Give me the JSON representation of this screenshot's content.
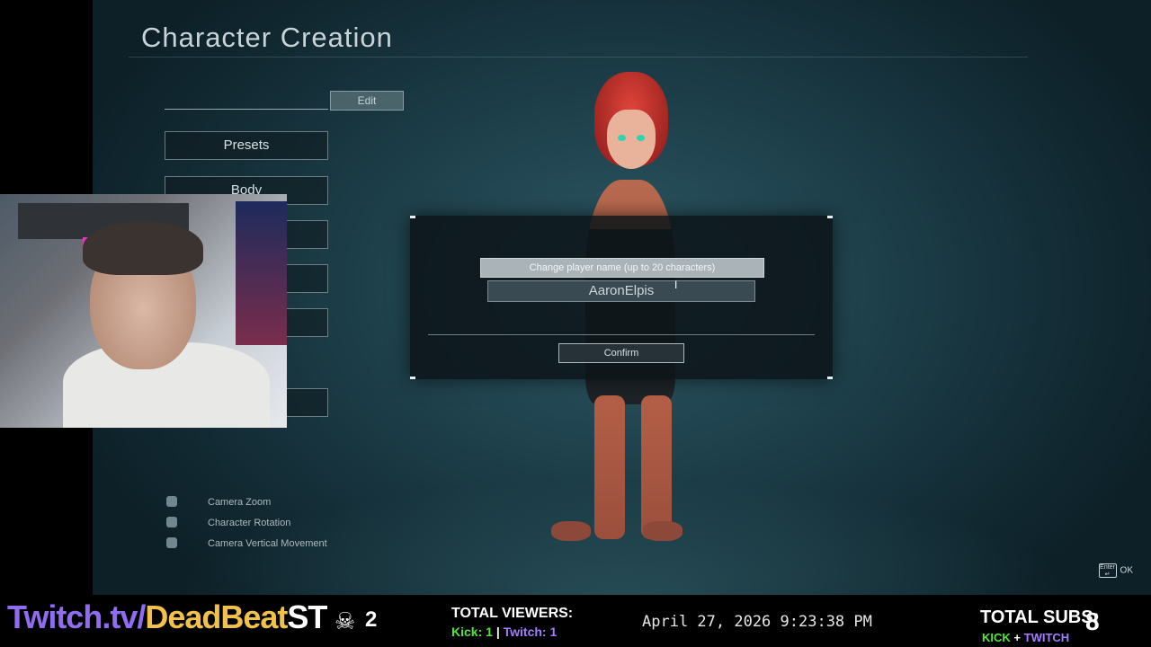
{
  "game": {
    "title": "Character Creation",
    "edit_label": "Edit",
    "menu": [
      "Presets",
      "Body",
      "",
      "",
      "",
      ""
    ],
    "hints": [
      {
        "icon": "mouse-scroll-icon",
        "label": "Camera Zoom"
      },
      {
        "icon": "mouse-drag-icon",
        "label": "Character Rotation"
      },
      {
        "icon": "mouse-vertical-icon",
        "label": "Camera Vertical Movement"
      }
    ],
    "ok_hint": {
      "key": "Enter ↵",
      "label": "OK"
    }
  },
  "dialog": {
    "header": "Change player name (up to 20 characters)",
    "name_value": "AaronElpis",
    "confirm_label": "Confirm"
  },
  "stream": {
    "brand_part1": "Twitch.tv/",
    "brand_part2": "DeadBeat",
    "brand_part3": "ST",
    "deaths": "2",
    "viewers_label": "TOTAL VIEWERS:",
    "kick_viewers": "Kick: 1",
    "twitch_viewers": "Twitch: 1",
    "separator": "|",
    "datetime": "April 27, 2026 9:23:38 PM",
    "subs_label": "TOTAL SUBS:",
    "subs_count": "8",
    "subs_kick": "KICK",
    "subs_plus": "+",
    "subs_twitch": "TWITCH"
  },
  "colors": {
    "kick": "#53e53a",
    "twitch": "#a57cff",
    "brand_gold": "#f0c24a"
  }
}
